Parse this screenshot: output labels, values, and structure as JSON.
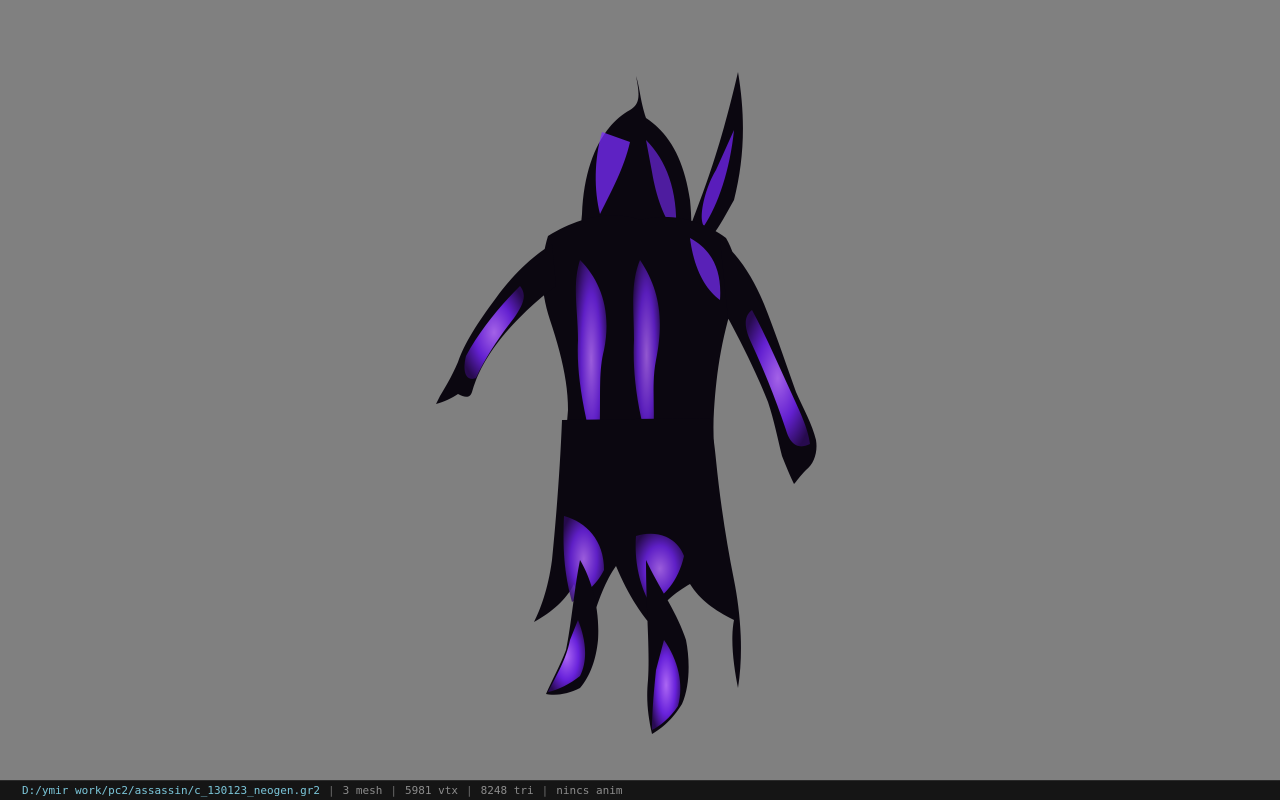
{
  "viewport": {
    "background": "#808080",
    "model": {
      "subject": "hooded assassin character",
      "primary_color": "#7b2cff",
      "shadow_color": "#0b0710"
    }
  },
  "status_bar": {
    "file_path": "D:/ymir work/pc2/assassin/c_130123_neogen.gr2",
    "separator": "|",
    "mesh": "3 mesh",
    "vertices": "5981 vtx",
    "triangles": "8248 tri",
    "animation": "nincs anim"
  }
}
